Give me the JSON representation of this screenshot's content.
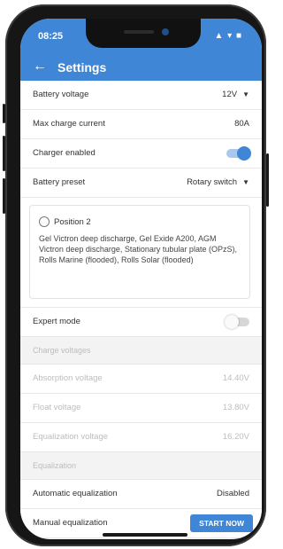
{
  "status": {
    "time": "08:25",
    "icons": "▲ ▾ ■"
  },
  "appbar": {
    "back_icon": "←",
    "title": "Settings"
  },
  "rows": {
    "battery_voltage": {
      "label": "Battery voltage",
      "value": "12V"
    },
    "max_charge_current": {
      "label": "Max charge current",
      "value": "80A"
    },
    "charger_enabled": {
      "label": "Charger enabled",
      "state": "on"
    },
    "battery_preset": {
      "label": "Battery preset",
      "value": "Rotary switch"
    }
  },
  "preset": {
    "title": "Position 2",
    "description": "Gel Victron deep discharge, Gel Exide A200, AGM Victron deep discharge, Stationary tubular plate (OPzS), Rolls Marine (flooded), Rolls Solar (flooded)"
  },
  "expert_mode": {
    "label": "Expert mode",
    "state": "off"
  },
  "charge_voltages": {
    "header": "Charge voltages",
    "absorption": {
      "label": "Absorption voltage",
      "value": "14.40V"
    },
    "float": {
      "label": "Float voltage",
      "value": "13.80V"
    },
    "equalization": {
      "label": "Equalization voltage",
      "value": "16.20V"
    }
  },
  "equalization": {
    "header": "Equalization",
    "automatic": {
      "label": "Automatic equalization",
      "value": "Disabled"
    },
    "manual": {
      "label": "Manual equalization",
      "button": "START NOW"
    }
  },
  "colors": {
    "accent": "#3f86d6",
    "disabled_text": "#bdbdbd"
  }
}
